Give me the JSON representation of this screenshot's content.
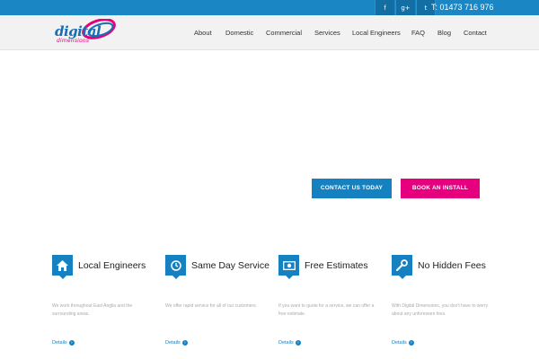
{
  "topbar": {
    "social": [
      {
        "name": "facebook-icon",
        "glyph": "f"
      },
      {
        "name": "google-plus-icon",
        "glyph": "g+"
      },
      {
        "name": "twitter-icon",
        "glyph": "t"
      }
    ],
    "phone": "T: 01473 716 976"
  },
  "header": {
    "logo_word": "digital",
    "logo_sub": "dimensions",
    "nav": [
      "About",
      "Domestic",
      "Commercial",
      "Services",
      "Local Engineers",
      "FAQ",
      "Blog",
      "Contact"
    ]
  },
  "hero": {
    "contact_label": "CONTACT US TODAY",
    "install_label": "BOOK AN INSTALL"
  },
  "features": [
    {
      "icon": "home-icon",
      "title": "Local Engineers",
      "text": "We work throughout East Anglia and the surrounding areas.",
      "link": "Details"
    },
    {
      "icon": "clock-icon",
      "title": "Same Day Service",
      "text": "We offer rapid service for all of our customers.",
      "link": "Details"
    },
    {
      "icon": "money-icon",
      "title": "Free Estimates",
      "text": "If you want to quote for a service, we can offer a free estimate.",
      "link": "Details"
    },
    {
      "icon": "wrench-icon",
      "title": "No Hidden Fees",
      "text": "With Digital Dimensions, you don't have to worry about any unforeseen fees.",
      "link": "Details"
    }
  ],
  "colors": {
    "brand_blue": "#1681c1",
    "brand_pink": "#e6007e",
    "topbar": "#1b86c4"
  }
}
